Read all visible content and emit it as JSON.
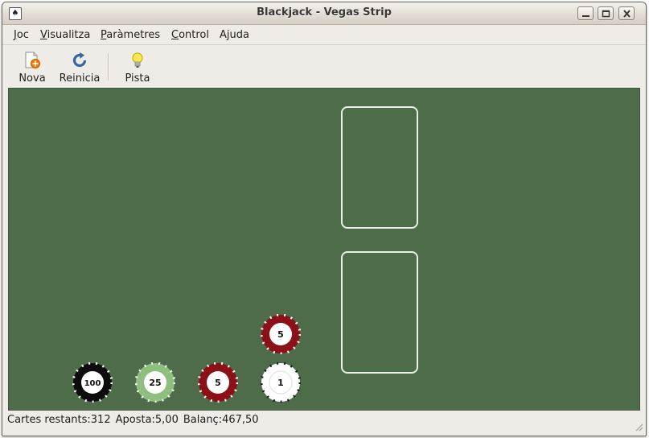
{
  "window": {
    "title": "Blackjack - Vegas Strip",
    "app_icon": "cards-icon",
    "controls": [
      "minimize-icon",
      "maximize-icon",
      "close-icon"
    ]
  },
  "menu": {
    "items": [
      {
        "mnemonic": "J",
        "rest": "oc"
      },
      {
        "mnemonic": "V",
        "rest": "isualitza"
      },
      {
        "mnemonic": "P",
        "rest": "aràmetres"
      },
      {
        "mnemonic": "C",
        "rest": "ontrol"
      },
      {
        "pre": "A",
        "mnemonic": "j",
        "rest": "uda"
      }
    ]
  },
  "toolbar": {
    "new_label": "Nova",
    "restart_label": "Reinicia",
    "hint_label": "Pista"
  },
  "table": {
    "felt_color": "#4e6c4a",
    "chips": {
      "stack_top": "5",
      "c100": "100",
      "c25": "25",
      "c5": "5",
      "c1": "1"
    }
  },
  "status": {
    "cards_left": "Cartes restants:312",
    "bet": "Aposta:5,00",
    "balance": "Balanç:467,50"
  }
}
